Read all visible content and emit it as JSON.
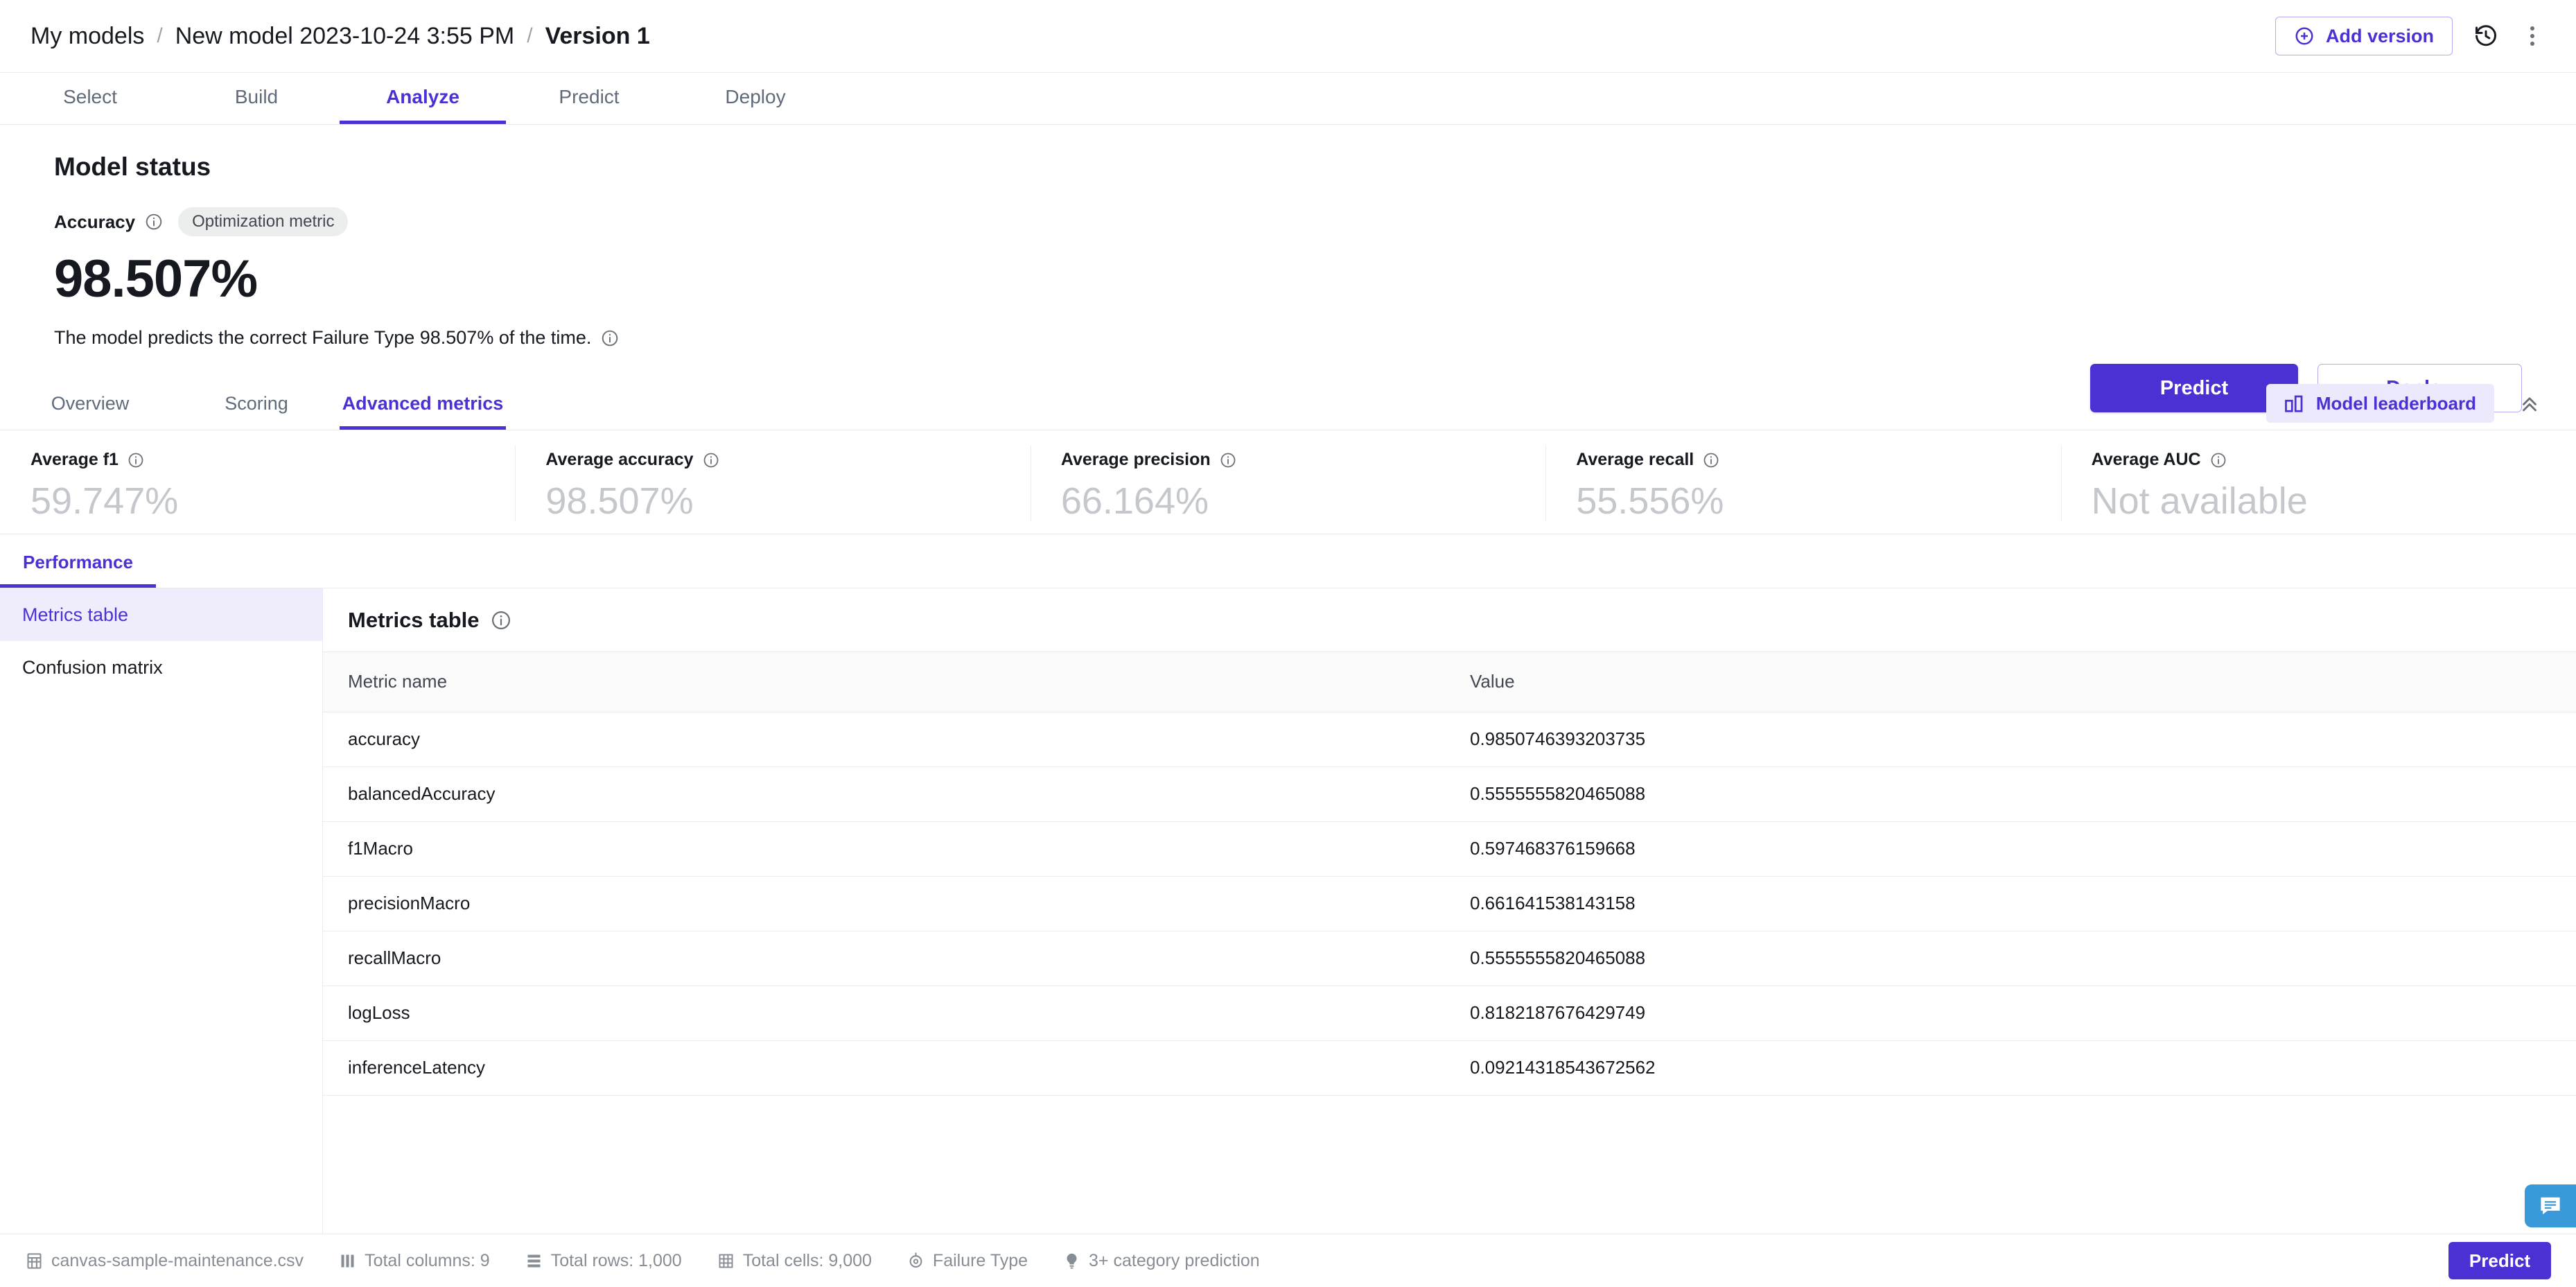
{
  "breadcrumb": {
    "root": "My models",
    "model": "New model 2023-10-24 3:55 PM",
    "version": "Version 1",
    "separator": "/"
  },
  "topbar": {
    "add_version_label": "Add version",
    "history_icon": "history-icon",
    "more_icon": "kebab-menu-icon"
  },
  "main_tabs": [
    {
      "label": "Select",
      "active": false
    },
    {
      "label": "Build",
      "active": false
    },
    {
      "label": "Analyze",
      "active": true
    },
    {
      "label": "Predict",
      "active": false
    },
    {
      "label": "Deploy",
      "active": false
    }
  ],
  "model_status": {
    "title": "Model status",
    "metric_label": "Accuracy",
    "badge": "Optimization metric",
    "value": "98.507%",
    "description": "The model predicts the correct Failure Type 98.507% of the time.",
    "predict_button": "Predict",
    "deploy_button": "Deploy"
  },
  "sub_tabs": [
    {
      "label": "Overview",
      "active": false
    },
    {
      "label": "Scoring",
      "active": false
    },
    {
      "label": "Advanced metrics",
      "active": true
    }
  ],
  "sub_tabs_right": {
    "leaderboard_label": "Model leaderboard",
    "leaderboard_icon": "bar-chart-icon",
    "collapse_icon": "double-chevron-up-icon"
  },
  "metric_cards": [
    {
      "label": "Average f1",
      "value": "59.747%"
    },
    {
      "label": "Average accuracy",
      "value": "98.507%"
    },
    {
      "label": "Average precision",
      "value": "66.164%"
    },
    {
      "label": "Average recall",
      "value": "55.556%"
    },
    {
      "label": "Average AUC",
      "value": "Not available"
    }
  ],
  "performance_tab": {
    "label": "Performance"
  },
  "side_nav": [
    {
      "label": "Metrics table",
      "active": true
    },
    {
      "label": "Confusion matrix",
      "active": false
    }
  ],
  "panel": {
    "title": "Metrics table",
    "columns": {
      "name": "Metric name",
      "value": "Value"
    },
    "rows": [
      {
        "name": "accuracy",
        "value": "0.9850746393203735"
      },
      {
        "name": "balancedAccuracy",
        "value": "0.5555555820465088"
      },
      {
        "name": "f1Macro",
        "value": "0.597468376159668"
      },
      {
        "name": "precisionMacro",
        "value": "0.661641538143158"
      },
      {
        "name": "recallMacro",
        "value": "0.5555555820465088"
      },
      {
        "name": "logLoss",
        "value": "0.8182187676429749"
      },
      {
        "name": "inferenceLatency",
        "value": "0.09214318543672562"
      }
    ]
  },
  "statusbar": {
    "items": [
      {
        "icon": "dataset-icon",
        "label": "canvas-sample-maintenance.csv"
      },
      {
        "icon": "columns-icon",
        "label": "Total columns: 9"
      },
      {
        "icon": "rows-icon",
        "label": "Total rows: 1,000"
      },
      {
        "icon": "cells-icon",
        "label": "Total cells: 9,000"
      },
      {
        "icon": "target-icon",
        "label": "Failure Type"
      },
      {
        "icon": "bulb-icon",
        "label": "3+ category prediction"
      }
    ],
    "predict_button": "Predict",
    "chat_icon": "chat-icon"
  },
  "colors": {
    "accent": "#4b31d4",
    "accent_soft": "#ece9fc",
    "accent_nav": "#efedfb",
    "muted_text": "#5f6b7a",
    "metric_value": "#c4c7cb",
    "chat": "#3a9ad9"
  }
}
